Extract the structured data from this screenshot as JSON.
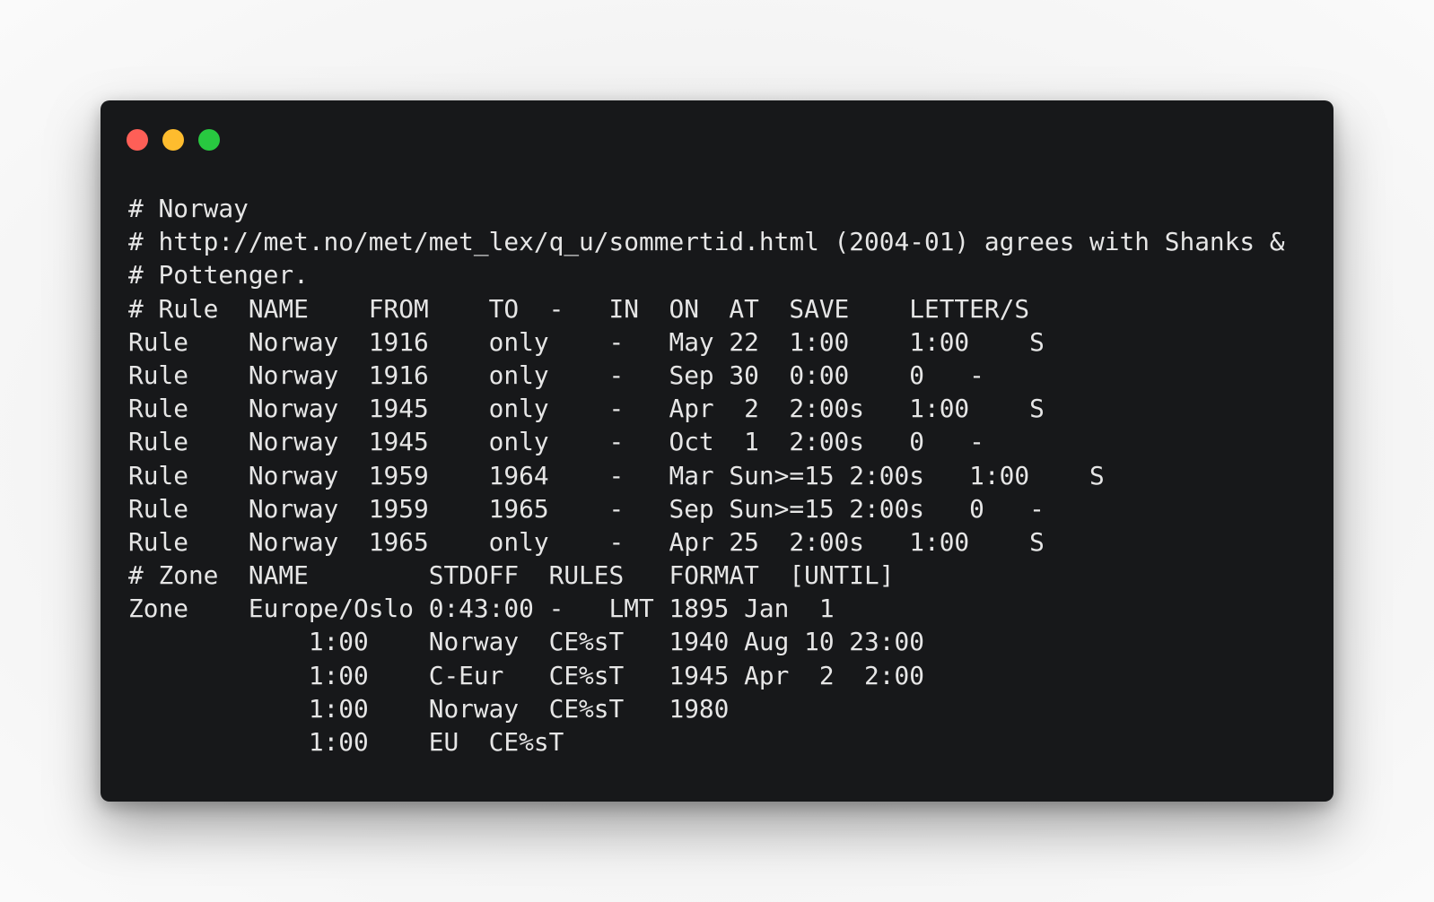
{
  "window": {
    "controls": {
      "close": {
        "icon": "close-dot-icon",
        "color": "#fe5f57"
      },
      "minimize": {
        "icon": "minimize-dot-icon",
        "color": "#febc2e"
      },
      "maximize": {
        "icon": "maximize-dot-icon",
        "color": "#28c840"
      }
    },
    "background": "#17181a",
    "text_color": "#e6e6e6"
  },
  "code": {
    "lines": [
      "# Norway",
      "# http://met.no/met/met_lex/q_u/sommertid.html (2004-01) agrees with Shanks &",
      "# Pottenger.",
      "# Rule  NAME    FROM    TO  -   IN  ON  AT  SAVE    LETTER/S",
      "Rule    Norway  1916    only    -   May 22  1:00    1:00    S",
      "Rule    Norway  1916    only    -   Sep 30  0:00    0   -",
      "Rule    Norway  1945    only    -   Apr  2  2:00s   1:00    S",
      "Rule    Norway  1945    only    -   Oct  1  2:00s   0   -",
      "Rule    Norway  1959    1964    -   Mar Sun>=15 2:00s   1:00    S",
      "Rule    Norway  1959    1965    -   Sep Sun>=15 2:00s   0   -",
      "Rule    Norway  1965    only    -   Apr 25  2:00s   1:00    S",
      "# Zone  NAME        STDOFF  RULES   FORMAT  [UNTIL]",
      "Zone    Europe/Oslo 0:43:00 -   LMT 1895 Jan  1",
      "            1:00    Norway  CE%sT   1940 Aug 10 23:00",
      "            1:00    C-Eur   CE%sT   1945 Apr  2  2:00",
      "            1:00    Norway  CE%sT   1980",
      "            1:00    EU  CE%sT"
    ]
  }
}
